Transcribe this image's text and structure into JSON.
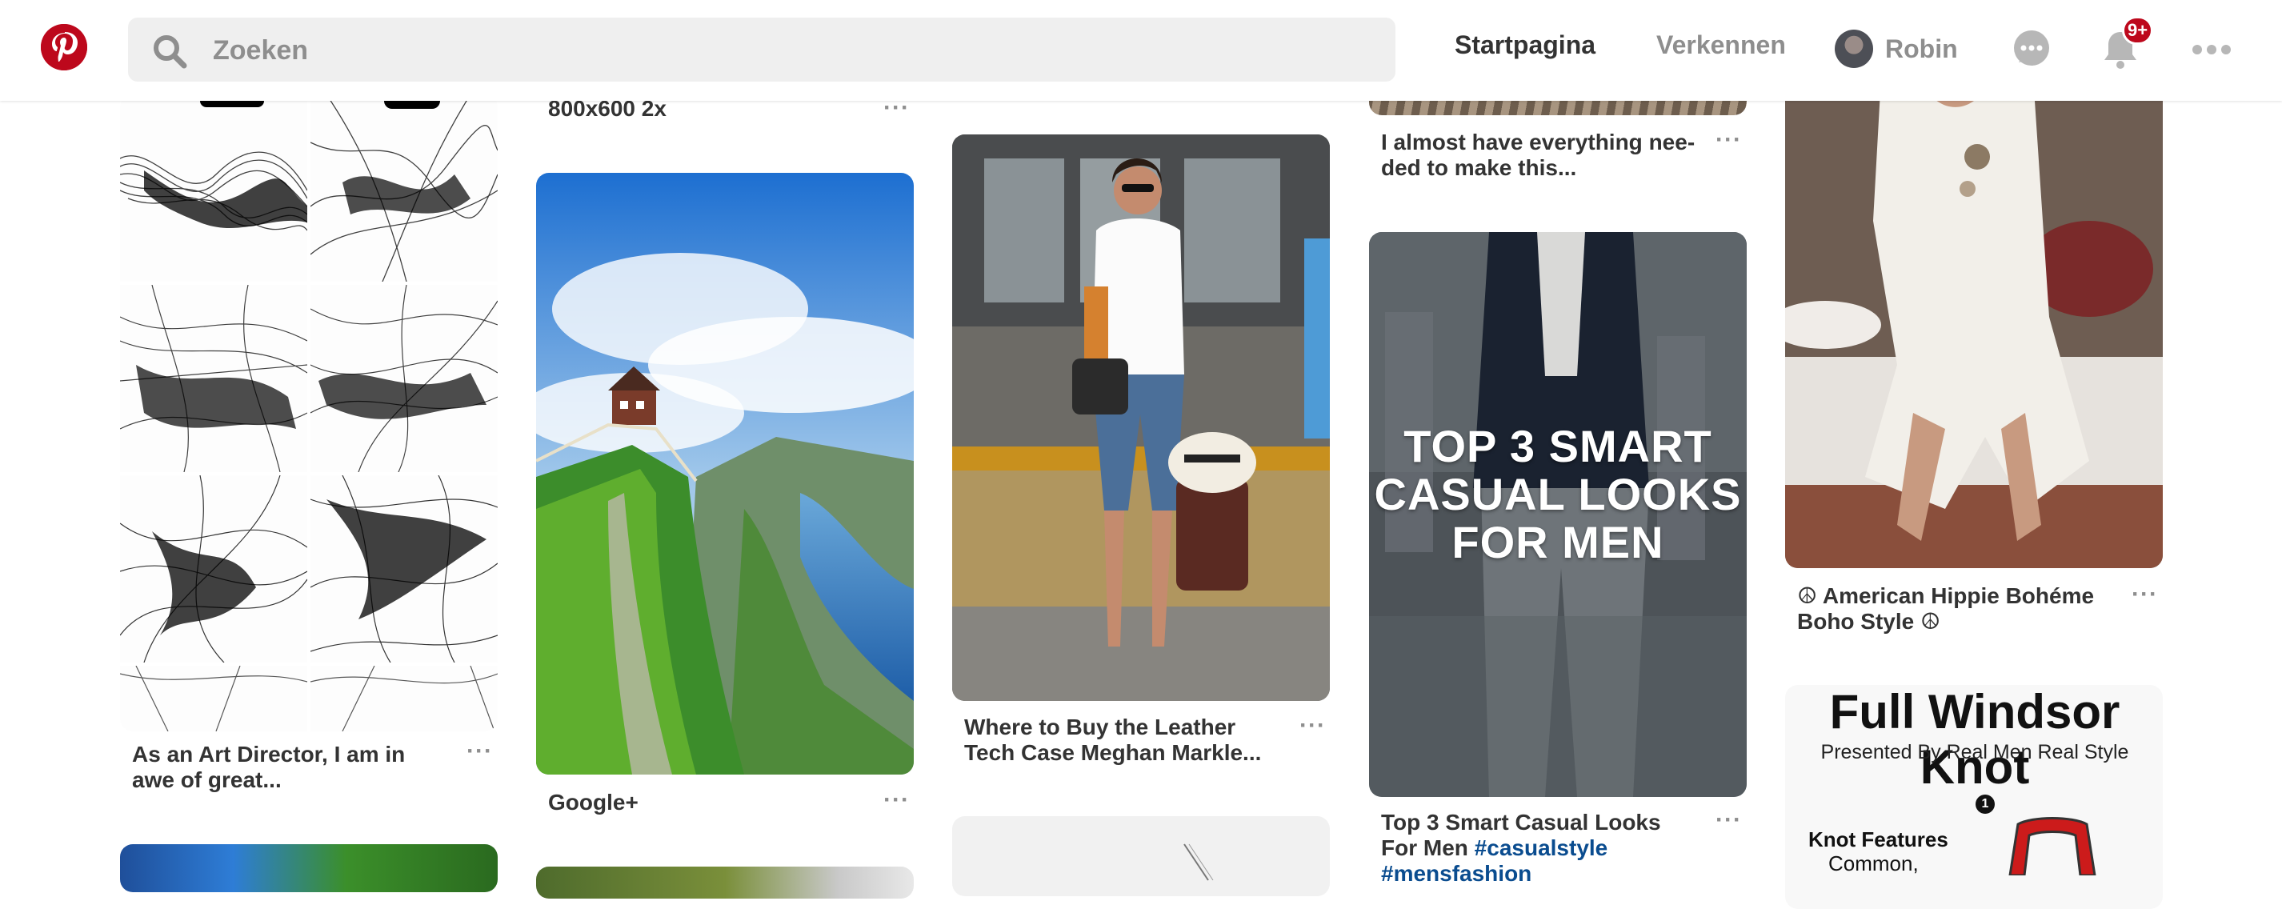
{
  "header": {
    "search_placeholder": "Zoeken",
    "nav_home": "Startpagina",
    "nav_explore": "Verkennen",
    "user_name": "Robin",
    "notification_count": "9+"
  },
  "pins": {
    "c1_caption": "As an Art Director, I am in awe of great...",
    "c2_top_caption": "800x600 2x",
    "c2_caption": "Google+",
    "c3_caption": "Where to Buy the Leather Tech Case Meghan Markle...",
    "c4_top_caption": "I almost have everything nee-ded to make this...",
    "c4_overlay": "TOP 3 SMART CASUAL LOOKS FOR MEN",
    "c4_caption_text": "Top 3 Smart Casual Looks For Men ",
    "c4_caption_tags": "#casualstyle #mensfashion",
    "c5_caption": "☮ American Hippie Bohéme Boho Style ☮",
    "c5_windsor_title": "Full Windsor Knot",
    "c5_windsor_sub": "Presented By Real Men Real Style",
    "c5_knot_features": "Knot Features",
    "c5_knot_common": "Common,",
    "c5_step": "1"
  },
  "colors": {
    "brand": "#bd081c",
    "muted": "#8e8e8e",
    "search_bg": "#efefef",
    "hashtag": "#0a4c8f"
  },
  "icons": [
    "pinterest-logo-icon",
    "search-icon",
    "chat-icon",
    "bell-icon",
    "more-icon"
  ]
}
